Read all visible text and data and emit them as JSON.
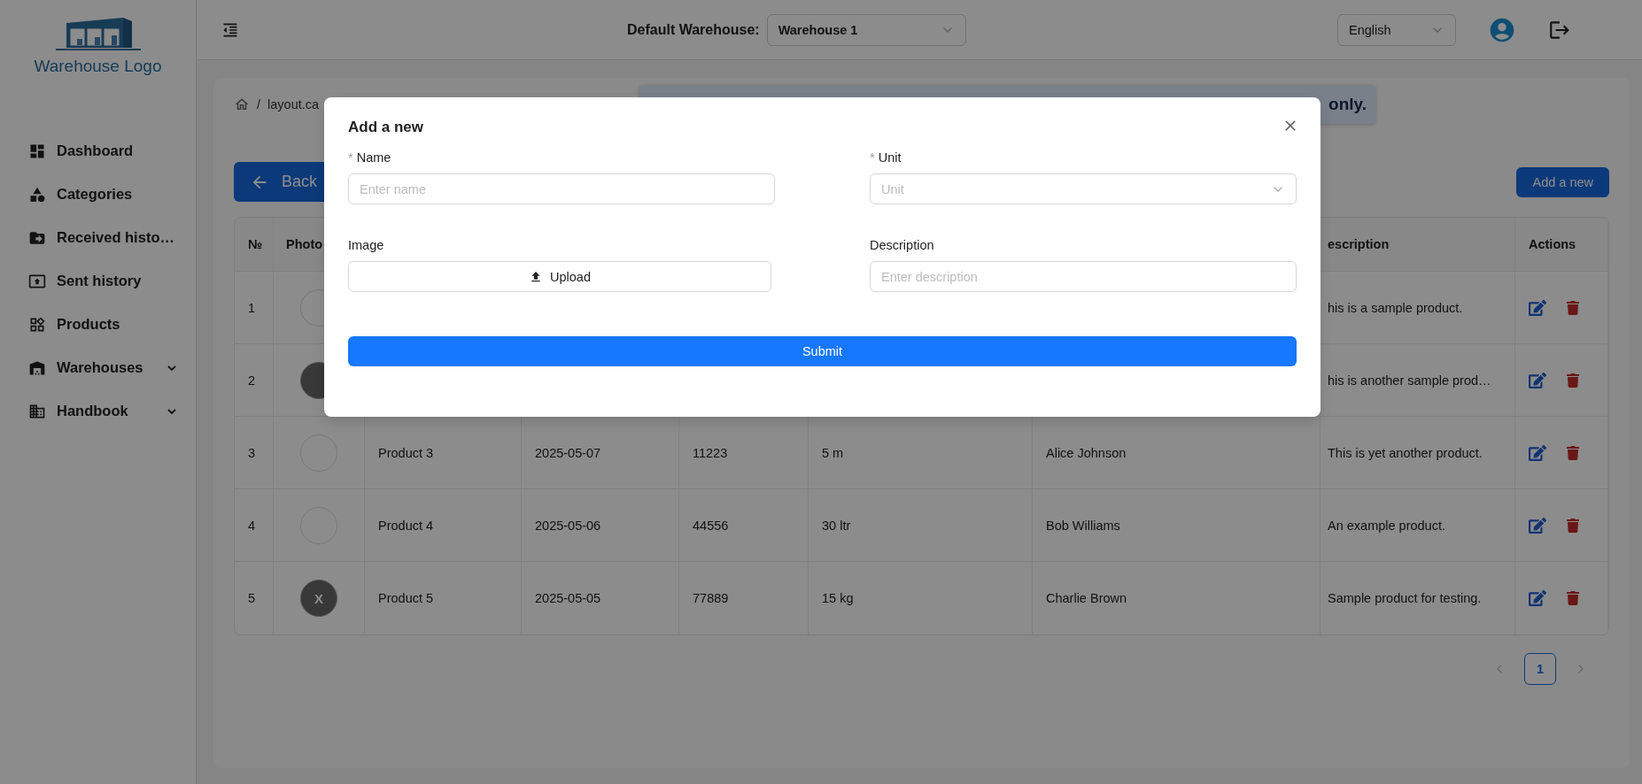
{
  "sidebar": {
    "logo": "Warehouse Logo",
    "items": [
      {
        "label": "Dashboard",
        "has_submenu": false
      },
      {
        "label": "Categories",
        "has_submenu": false
      },
      {
        "label": "Received histo…",
        "has_submenu": false
      },
      {
        "label": "Sent history",
        "has_submenu": false
      },
      {
        "label": "Products",
        "has_submenu": false
      },
      {
        "label": "Warehouses",
        "has_submenu": true
      },
      {
        "label": "Handbook",
        "has_submenu": true
      }
    ]
  },
  "header": {
    "warehouse_label": "Default Warehouse:",
    "warehouse_select": "Warehouse 1",
    "language_select": "English"
  },
  "breadcrumb": {
    "separator": "/",
    "current": "layout.ca"
  },
  "banner": "only.",
  "back_button": "Back",
  "add_button": "Add a new",
  "table": {
    "header": {
      "column_1": "№",
      "column_2": "Photo",
      "column_8": "escription",
      "column_9": "Actions"
    },
    "rows": [
      {
        "no": "1",
        "photo_placeholder": false,
        "description": "his is a sample product."
      },
      {
        "no": "2",
        "photo_placeholder": true,
        "description": "his is another sample prod…"
      },
      {
        "no": "3",
        "photo_placeholder": false,
        "name": "Product 3",
        "date": "2025-05-07",
        "code": "11223",
        "quantity": "5 m",
        "person": "Alice Johnson",
        "description": "This is yet another product."
      },
      {
        "no": "4",
        "photo_placeholder": false,
        "name": "Product 4",
        "date": "2025-05-06",
        "code": "44556",
        "quantity": "30 ltr",
        "person": "Bob Williams",
        "description": "An example product."
      },
      {
        "no": "5",
        "photo_placeholder": true,
        "photo_text": "X",
        "name": "Product 5",
        "date": "2025-05-05",
        "code": "77889",
        "quantity": "15 kg",
        "person": "Charlie Brown",
        "description": "Sample product for testing."
      }
    ]
  },
  "pagination": {
    "prev_disabled": true,
    "next_disabled": true,
    "pages": [
      {
        "label": "1",
        "selected": true
      }
    ]
  },
  "modal": {
    "title": "Add a new",
    "fields": [
      {
        "kind": "input",
        "label": "Name",
        "required_mark": "*",
        "placeholder": "Enter name"
      },
      {
        "kind": "select",
        "label": "Unit",
        "required_mark": "*",
        "placeholder": "Unit"
      },
      {
        "kind": "upload",
        "label": "Image",
        "button": "Upload"
      },
      {
        "kind": "input",
        "label": "Description",
        "placeholder": "Enter description"
      }
    ],
    "submit": "Submit"
  }
}
